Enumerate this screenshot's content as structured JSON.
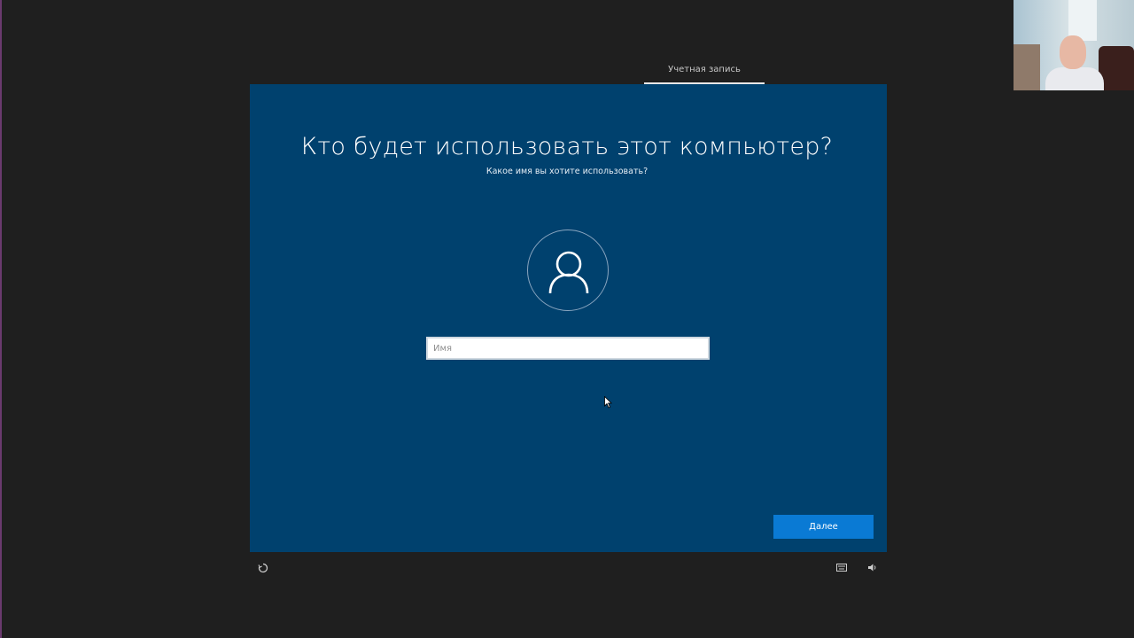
{
  "header": {
    "active_tab": "Учетная запись"
  },
  "main": {
    "title": "Кто будет использовать этот компьютер?",
    "subtitle": "Какое имя вы хотите использовать?",
    "name_input": {
      "value": "",
      "placeholder": "Имя"
    },
    "next_label": "Далее"
  },
  "footer": {
    "left_icon": "ease-of-access-icon",
    "right_icons": [
      "keyboard-icon",
      "speaker-icon"
    ]
  },
  "colors": {
    "panel": "#00416e",
    "accent": "#0a7ad4",
    "background": "#1f1f1f"
  }
}
